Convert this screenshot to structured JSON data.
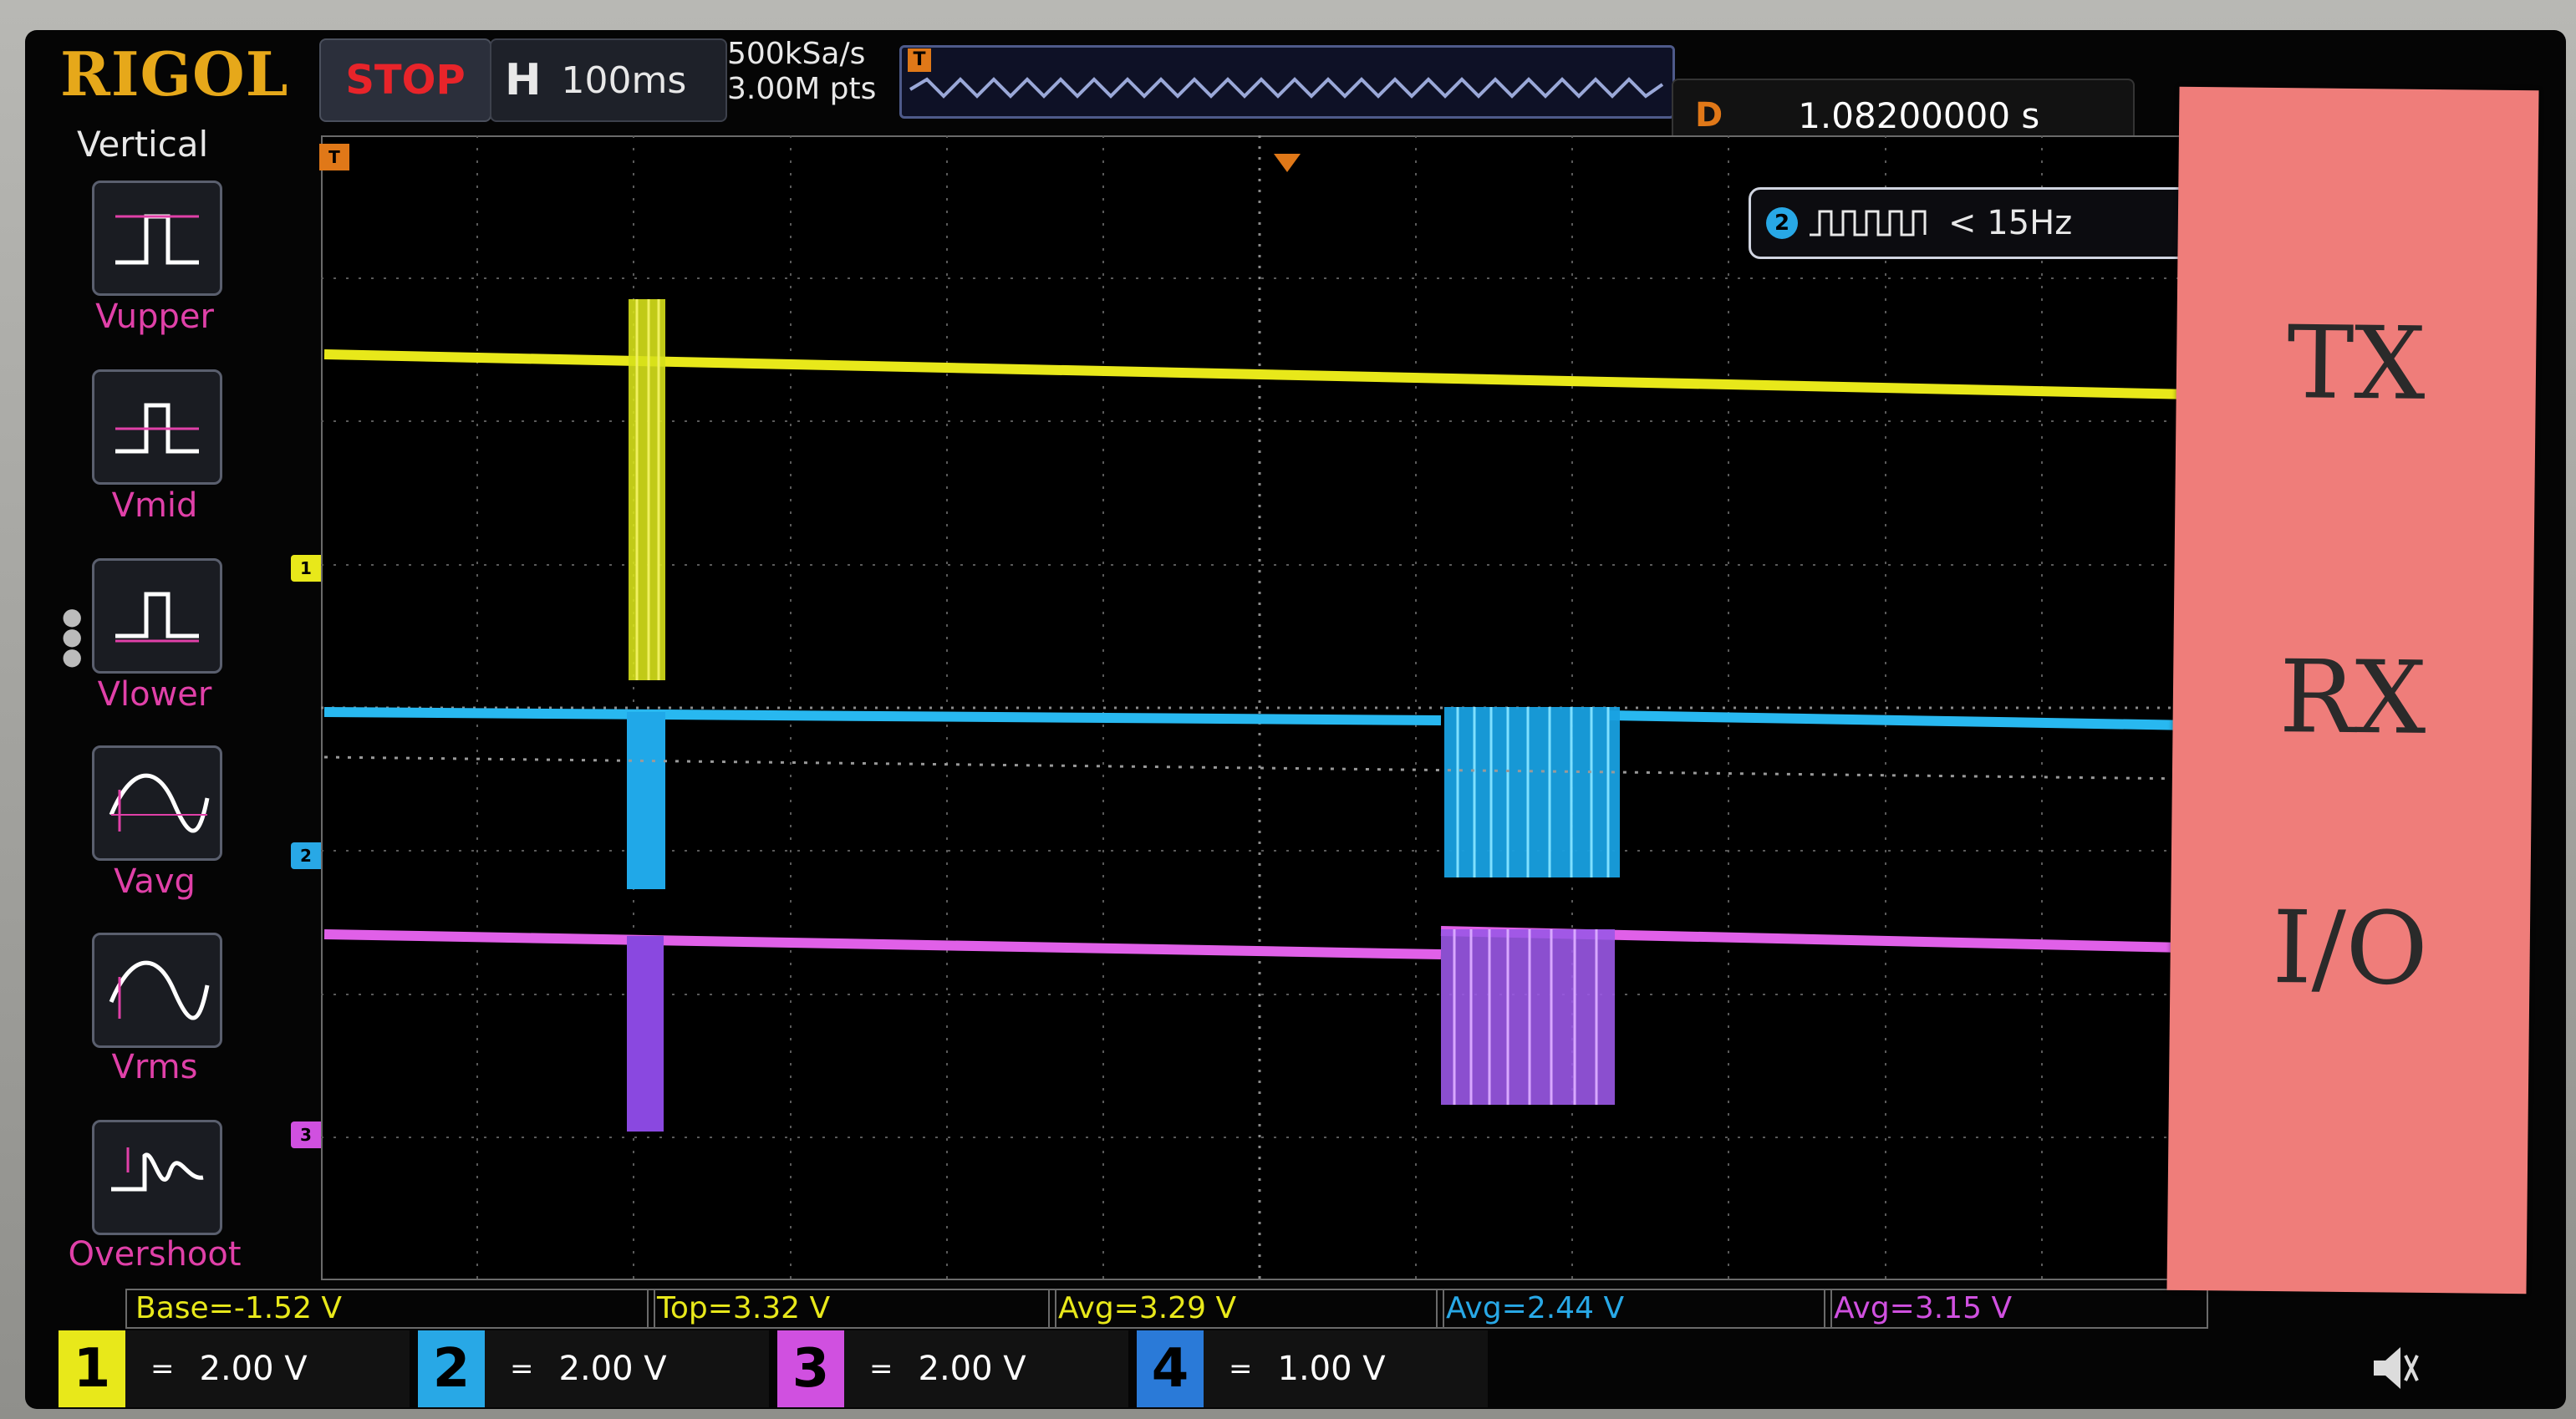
{
  "brand": "RIGOL",
  "status": "STOP",
  "horizontal": {
    "label": "H",
    "timebase": "100ms"
  },
  "sample_rate": "500kSa/s",
  "memory_depth": "3.00M pts",
  "delay": {
    "label": "D",
    "value": "1.08200000 s"
  },
  "trigger_label": "T",
  "freq_readout": {
    "channel": "2",
    "value": "< 15Hz"
  },
  "menu": {
    "title": "Vertical",
    "items": [
      {
        "label": "Vupper"
      },
      {
        "label": "Vmid"
      },
      {
        "label": "Vlower"
      },
      {
        "label": "Vavg"
      },
      {
        "label": "Vrms"
      },
      {
        "label": "Overshoot"
      }
    ]
  },
  "channel_markers": [
    "1",
    "2",
    "3"
  ],
  "measurements": [
    "Base=-1.52 V",
    "Top=3.32 V",
    "Avg=3.29 V",
    "Avg=2.44 V",
    "Avg=3.15 V"
  ],
  "channels": [
    {
      "num": "1",
      "scale": "2.00 V",
      "coupling": "=",
      "color": "#e8e81a"
    },
    {
      "num": "2",
      "scale": "2.00 V",
      "coupling": "=",
      "color": "#28a8e6"
    },
    {
      "num": "3",
      "scale": "2.00 V",
      "coupling": "=",
      "color": "#d050e0"
    },
    {
      "num": "4",
      "scale": "1.00 V",
      "coupling": "=",
      "color": "#2a7ad8"
    }
  ],
  "note": {
    "line1": "TX",
    "line2": "RX",
    "line3": "I/O"
  },
  "colors": {
    "ch1": "#e8e81a",
    "ch2": "#28a8e6",
    "ch3": "#d050e0",
    "trigger": "#e07818",
    "menu_label": "#e040a8"
  }
}
